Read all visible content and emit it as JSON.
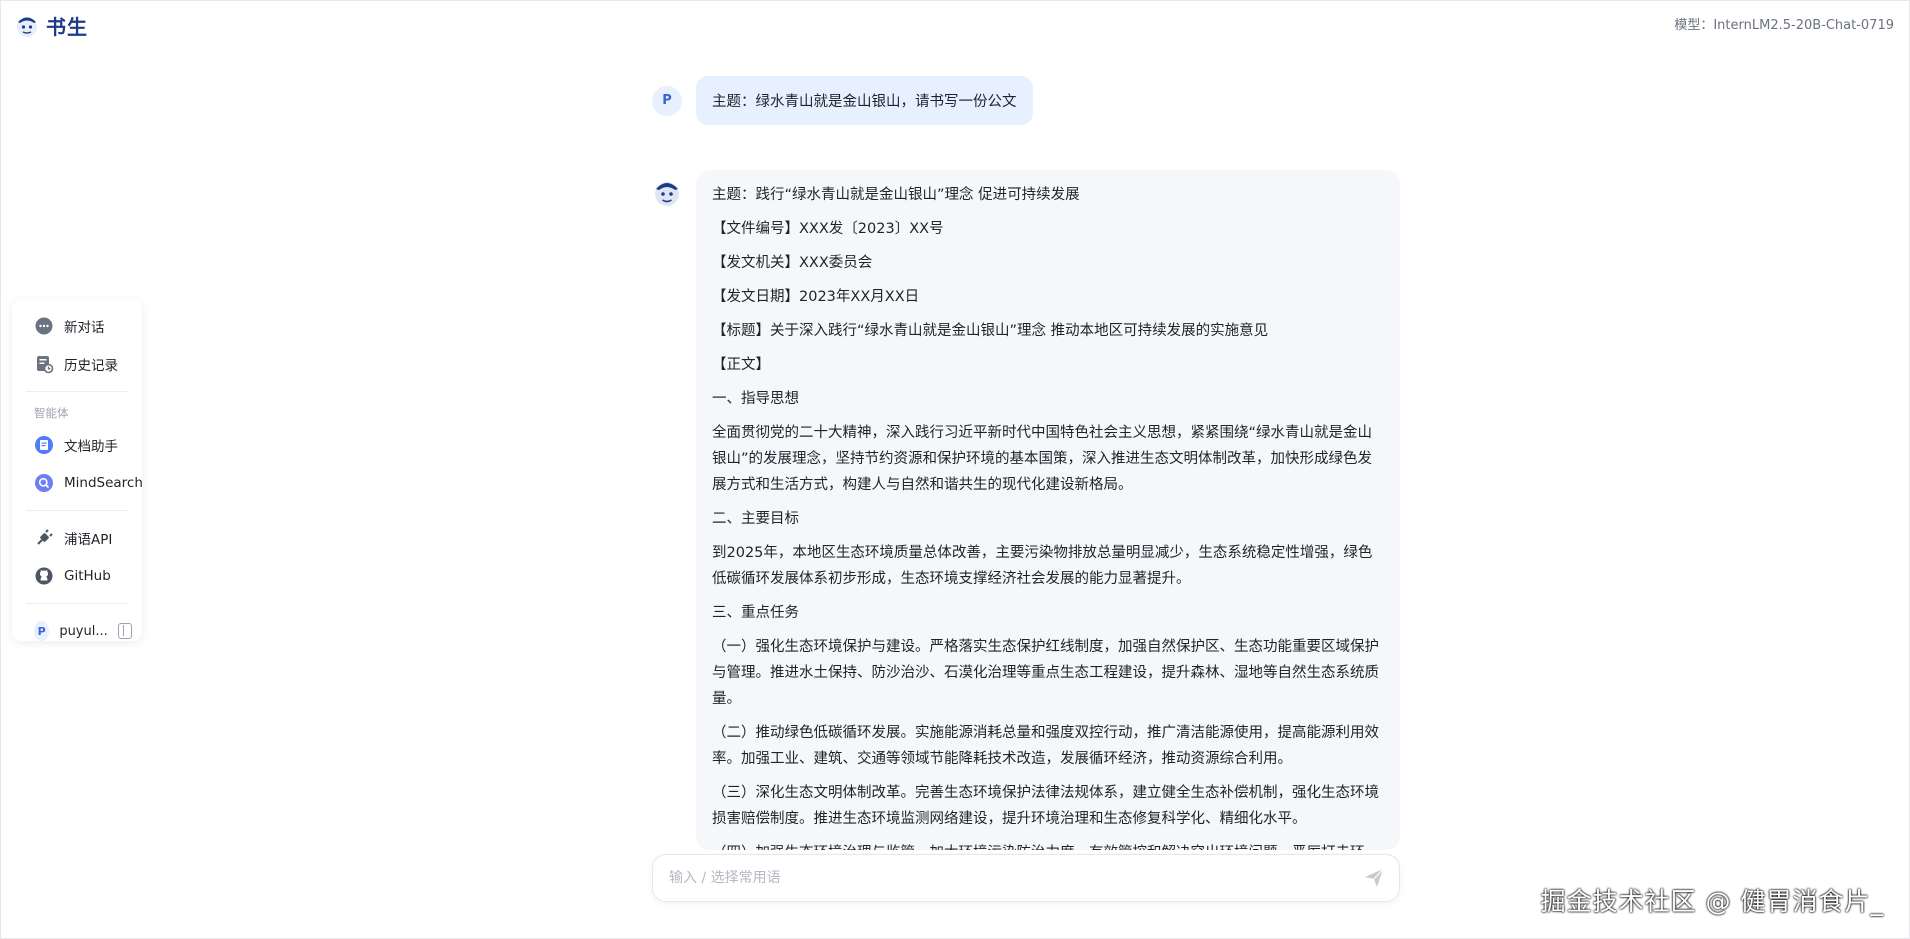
{
  "header": {
    "logo_text": "书生",
    "model_label": "模型：InternLM2.5-20B-Chat-0719"
  },
  "sidebar": {
    "items": [
      {
        "label": "新对话",
        "icon": "chat-bubble-icon"
      },
      {
        "label": "历史记录",
        "icon": "history-icon"
      }
    ],
    "section_label": "智能体",
    "agents": [
      {
        "label": "文档助手",
        "icon": "document-assistant-icon"
      },
      {
        "label": "MindSearch",
        "icon": "mindsearch-icon"
      }
    ],
    "links": [
      {
        "label": "浦语API",
        "icon": "plug-icon"
      },
      {
        "label": "GitHub",
        "icon": "github-icon"
      }
    ],
    "user": {
      "avatar_letter": "P",
      "name": "puyul..."
    }
  },
  "chat": {
    "user_message": {
      "avatar_letter": "P",
      "text": "主题：绿水青山就是金山银山，请书写一份公文"
    },
    "bot_message": {
      "paragraphs": [
        "主题：践行“绿水青山就是金山银山”理念 促进可持续发展",
        "【文件编号】XXX发〔2023〕XX号",
        "【发文机关】XXX委员会",
        "【发文日期】2023年XX月XX日",
        "【标题】关于深入践行“绿水青山就是金山银山”理念 推动本地区可持续发展的实施意见",
        "【正文】",
        "一、指导思想",
        "全面贯彻党的二十大精神，深入践行习近平新时代中国特色社会主义思想，紧紧围绕“绿水青山就是金山银山”的发展理念，坚持节约资源和保护环境的基本国策，深入推进生态文明体制改革，加快形成绿色发展方式和生活方式，构建人与自然和谐共生的现代化建设新格局。",
        "二、主要目标",
        "到2025年，本地区生态环境质量总体改善，主要污染物排放总量明显减少，生态系统稳定性增强，绿色低碳循环发展体系初步形成，生态环境支撑经济社会发展的能力显著提升。",
        "三、重点任务",
        "（一）强化生态环境保护与建设。严格落实生态保护红线制度，加强自然保护区、生态功能重要区域保护与管理。推进水土保持、防沙治沙、石漠化治理等重点生态工程建设，提升森林、湿地等自然生态系统质量。",
        "（二）推动绿色低碳循环发展。实施能源消耗总量和强度双控行动，推广清洁能源使用，提高能源利用效率。加强工业、建筑、交通等领域节能降耗技术改造，发展循环经济，推动资源综合利用。",
        "（三）深化生态文明体制改革。完善生态环境保护法律法规体系，建立健全生态补偿机制，强化生态环境损害赔偿制度。推进生态环境监测网络建设，提升环境治理和生态修复科学化、精细化水平。",
        "（四）加强生态环境治理与监管。加大环境污染防治力度，有效管控和解决突出环境问题，严厉打击环"
      ]
    }
  },
  "input": {
    "placeholder": "输入 / 选择常用语",
    "value": ""
  },
  "watermark": "掘金技术社区 @ 健胃消食片_",
  "colors": {
    "accent": "#3b63d6",
    "user_bubble": "#e7f0ff",
    "bot_bubble": "#f5f7fa"
  }
}
